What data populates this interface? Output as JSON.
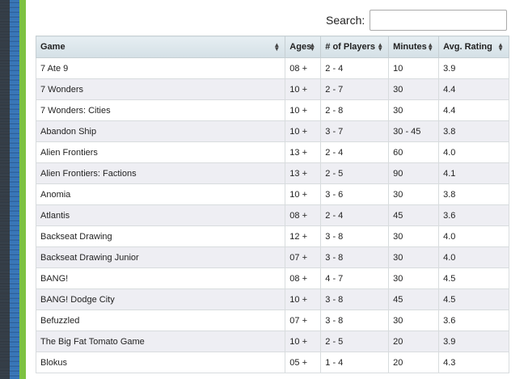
{
  "search": {
    "label": "Search:",
    "value": ""
  },
  "table": {
    "columns": [
      "Game",
      "Ages",
      "# of Players",
      "Minutes",
      "Avg. Rating"
    ],
    "rows": [
      [
        "7 Ate 9",
        "08 +",
        "2 - 4",
        "10",
        "3.9"
      ],
      [
        "7 Wonders",
        "10 +",
        "2 - 7",
        "30",
        "4.4"
      ],
      [
        "7 Wonders: Cities",
        "10 +",
        "2 - 8",
        "30",
        "4.4"
      ],
      [
        "Abandon Ship",
        "10 +",
        "3 - 7",
        "30 - 45",
        "3.8"
      ],
      [
        "Alien Frontiers",
        "13 +",
        "2 - 4",
        "60",
        "4.0"
      ],
      [
        "Alien Frontiers: Factions",
        "13 +",
        "2 - 5",
        "90",
        "4.1"
      ],
      [
        "Anomia",
        "10 +",
        "3 - 6",
        "30",
        "3.8"
      ],
      [
        "Atlantis",
        "08 +",
        "2 - 4",
        "45",
        "3.6"
      ],
      [
        "Backseat Drawing",
        "12 +",
        "3 - 8",
        "30",
        "4.0"
      ],
      [
        "Backseat Drawing Junior",
        "07 +",
        "3 - 8",
        "30",
        "4.0"
      ],
      [
        "BANG!",
        "08 +",
        "4 - 7",
        "30",
        "4.5"
      ],
      [
        "BANG! Dodge City",
        "10 +",
        "3 - 8",
        "45",
        "4.5"
      ],
      [
        "Befuzzled",
        "07 +",
        "3 - 8",
        "30",
        "3.6"
      ],
      [
        "The Big Fat Tomato Game",
        "10 +",
        "2 - 5",
        "20",
        "3.9"
      ],
      [
        "Blokus",
        "05 +",
        "1 - 4",
        "20",
        "4.3"
      ]
    ]
  }
}
